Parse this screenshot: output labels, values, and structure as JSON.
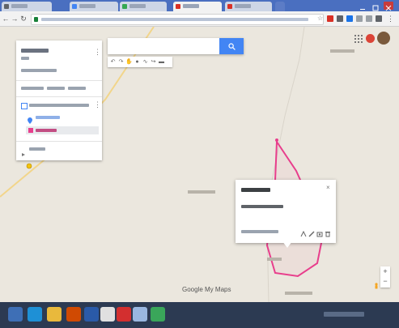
{
  "browser": {
    "tabs": [
      {
        "label": "",
        "active": false
      },
      {
        "label": "",
        "active": false
      },
      {
        "label": "",
        "active": false
      },
      {
        "label": "",
        "active": true
      },
      {
        "label": "",
        "active": false
      }
    ],
    "url": ""
  },
  "map_search": {
    "placeholder": "",
    "value": ""
  },
  "left_panel": {
    "map_title": "",
    "map_subtitle": "",
    "map_description": "",
    "actions": [
      "",
      "",
      ""
    ],
    "layer": {
      "name": "",
      "style_label": "",
      "feature_label": ""
    },
    "base_map_label": ""
  },
  "place_labels": [
    "",
    "",
    "",
    ""
  ],
  "info_card": {
    "title": "",
    "coords": "",
    "footer_text": ""
  },
  "footer": {
    "logo_text": "Google My Maps",
    "attribution": ""
  },
  "taskbar": {
    "clock_time": "",
    "clock_date": ""
  },
  "colors": {
    "shape_stroke": "#e83e8c",
    "search_button": "#4285f4",
    "tab_bar": "#4a6fc0",
    "taskbar": "#2c3a52"
  }
}
